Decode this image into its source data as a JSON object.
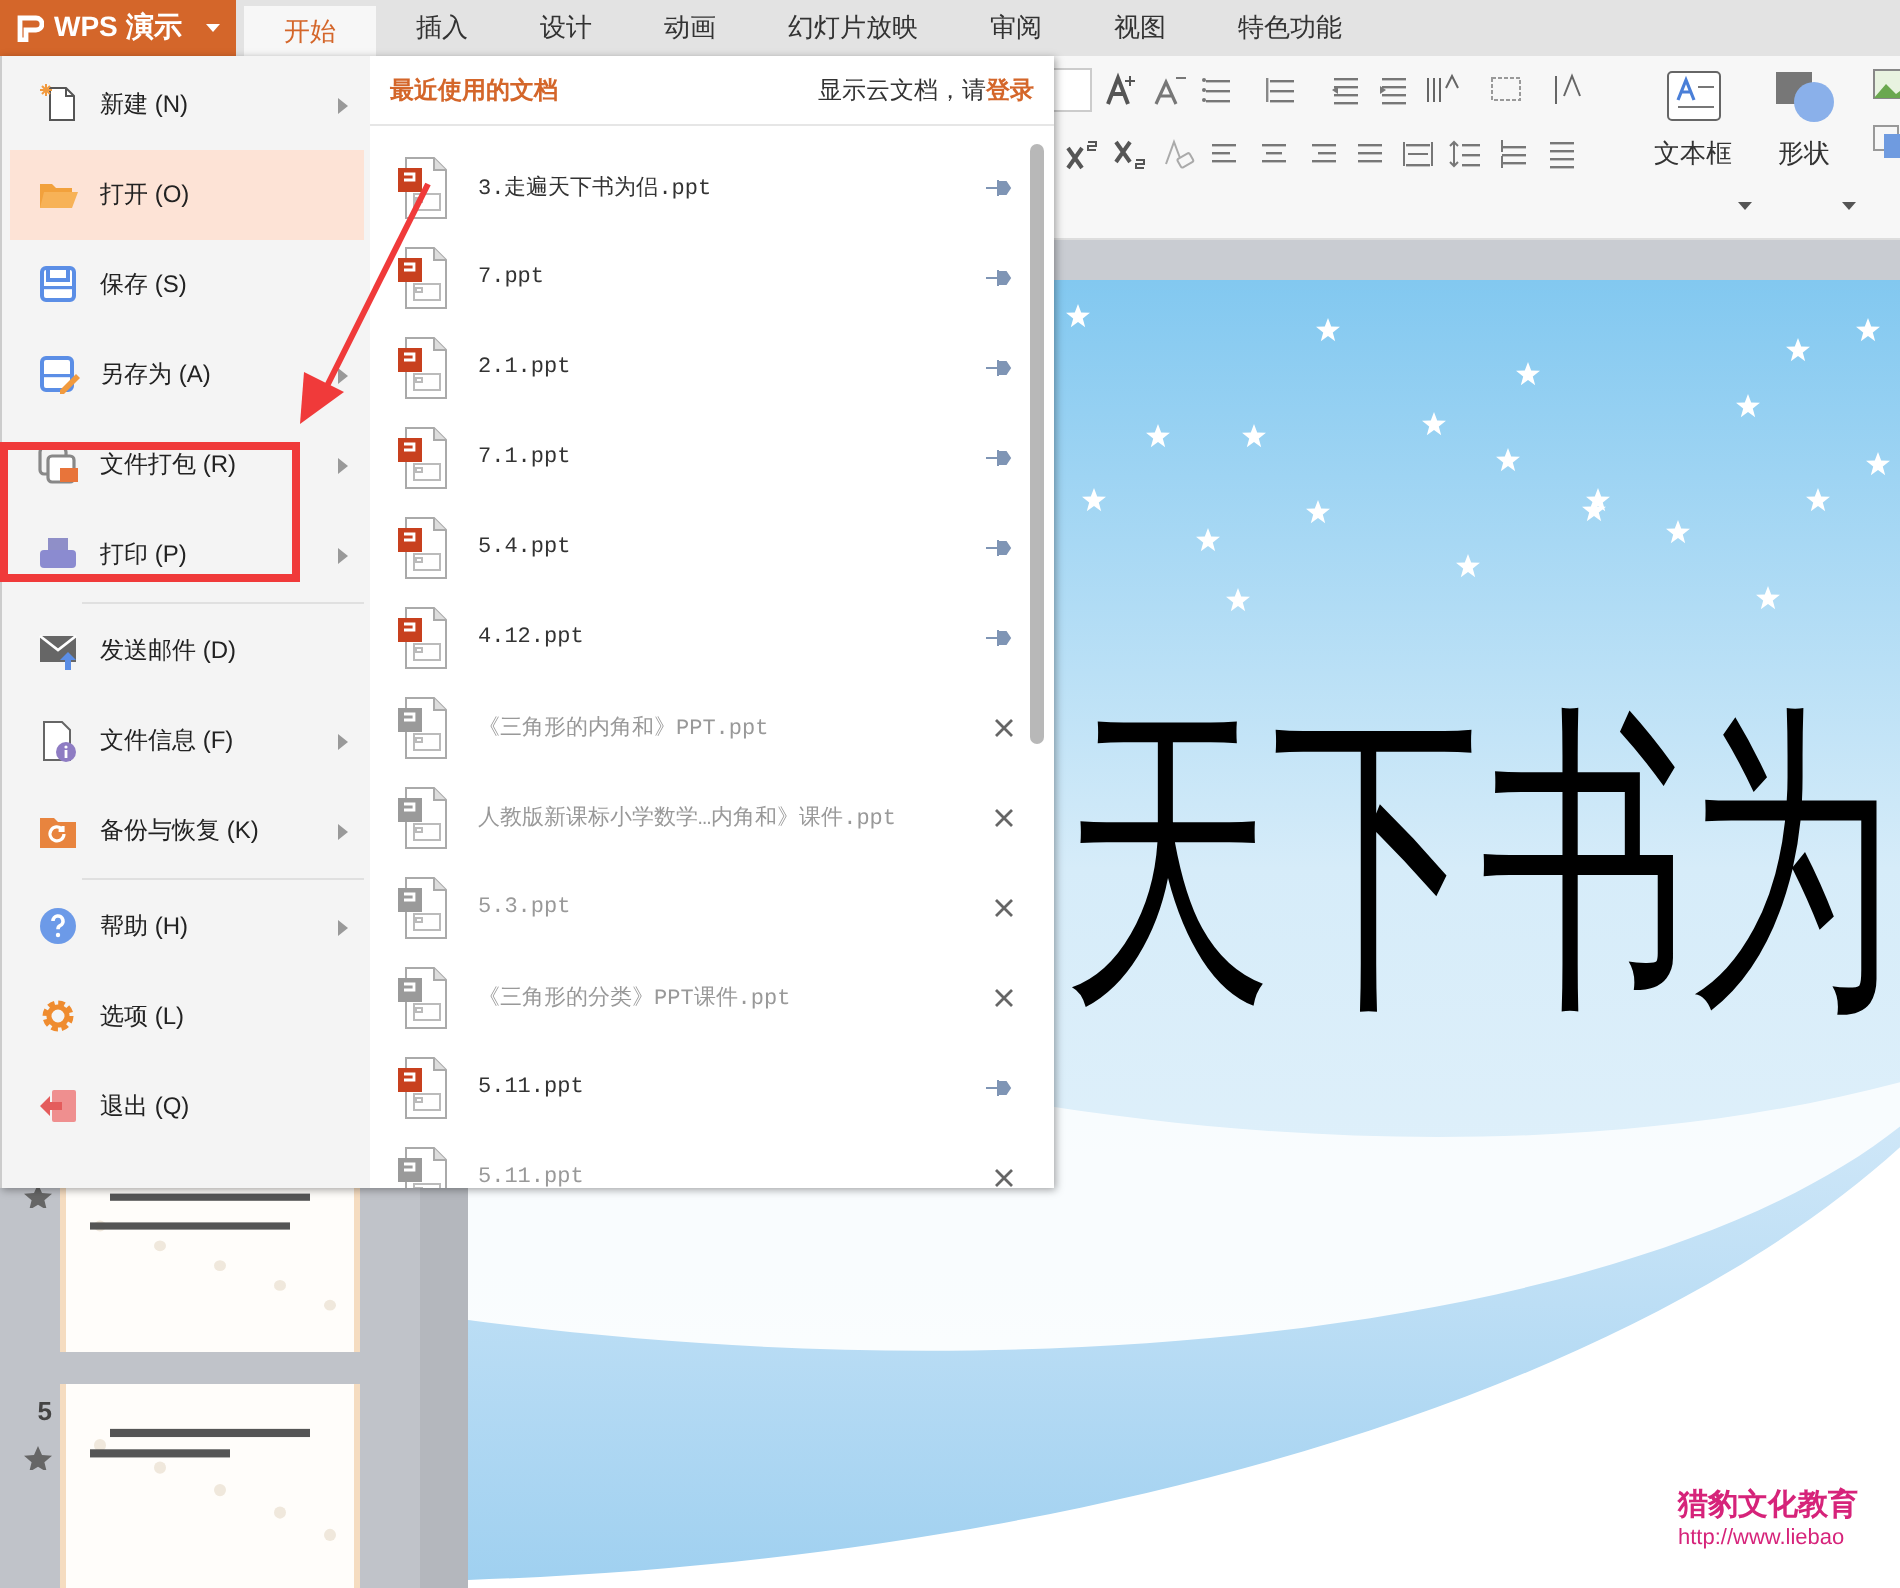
{
  "app_button": {
    "label": "WPS 演示"
  },
  "tabs": [
    {
      "label": "开始",
      "selected": true
    },
    {
      "label": "插入",
      "selected": false
    },
    {
      "label": "设计",
      "selected": false
    },
    {
      "label": "动画",
      "selected": false
    },
    {
      "label": "幻灯片放映",
      "selected": false
    },
    {
      "label": "审阅",
      "selected": false
    },
    {
      "label": "视图",
      "selected": false
    },
    {
      "label": "特色功能",
      "selected": false
    }
  ],
  "ribbon": {
    "buttons": [
      {
        "label": "文本框"
      },
      {
        "label": "形状"
      }
    ]
  },
  "file_menu": {
    "groups": [
      [
        {
          "label": "新建",
          "key": "(N)",
          "submenu": true,
          "selected": false
        },
        {
          "label": "打开",
          "key": "(O)",
          "submenu": false,
          "selected": true
        },
        {
          "label": "保存",
          "key": "(S)",
          "submenu": false,
          "selected": false
        },
        {
          "label": "另存为",
          "key": "(A)",
          "submenu": true,
          "selected": false
        },
        {
          "label": "文件打包",
          "key": "(R)",
          "submenu": true,
          "selected": false
        },
        {
          "label": "打印",
          "key": "(P)",
          "submenu": true,
          "selected": false
        }
      ],
      [
        {
          "label": "发送邮件",
          "key": "(D)",
          "submenu": false,
          "selected": false
        },
        {
          "label": "文件信息",
          "key": "(F)",
          "submenu": true,
          "selected": false
        },
        {
          "label": "备份与恢复",
          "key": "(K)",
          "submenu": true,
          "selected": false
        }
      ],
      [
        {
          "label": "帮助",
          "key": "(H)",
          "submenu": true,
          "selected": false
        },
        {
          "label": "选项",
          "key": "(L)",
          "submenu": false,
          "selected": false
        },
        {
          "label": "退出",
          "key": "(Q)",
          "submenu": false,
          "selected": false
        }
      ]
    ]
  },
  "recent": {
    "title": "最近使用的文档",
    "cloud_text": "显示云文档，请",
    "login_link": "登录",
    "files": [
      {
        "name": "3.走遍天下书为侣.ppt",
        "pinned": true
      },
      {
        "name": "7.ppt",
        "pinned": true
      },
      {
        "name": "2.1.ppt",
        "pinned": true
      },
      {
        "name": "7.1.ppt",
        "pinned": true
      },
      {
        "name": "5.4.ppt",
        "pinned": true
      },
      {
        "name": "4.12.ppt",
        "pinned": true
      },
      {
        "name": "《三角形的内角和》PPT.ppt",
        "pinned": false
      },
      {
        "name": "人教版新课标小学数学…内角和》课件.ppt",
        "pinned": false
      },
      {
        "name": "5.3.ppt",
        "pinned": false
      },
      {
        "name": "《三角形的分类》PPT课件.ppt",
        "pinned": false
      },
      {
        "name": "5.11.ppt",
        "pinned": true
      },
      {
        "name": "5.11.ppt",
        "pinned": false
      }
    ]
  },
  "slide_panel": {
    "slides": [
      {
        "animated": true
      },
      {
        "number": "5",
        "animated": true
      }
    ]
  },
  "slide": {
    "title": "天下书为",
    "footer_name": "猎豹文化教育",
    "footer_url": "http://www.liebao"
  }
}
